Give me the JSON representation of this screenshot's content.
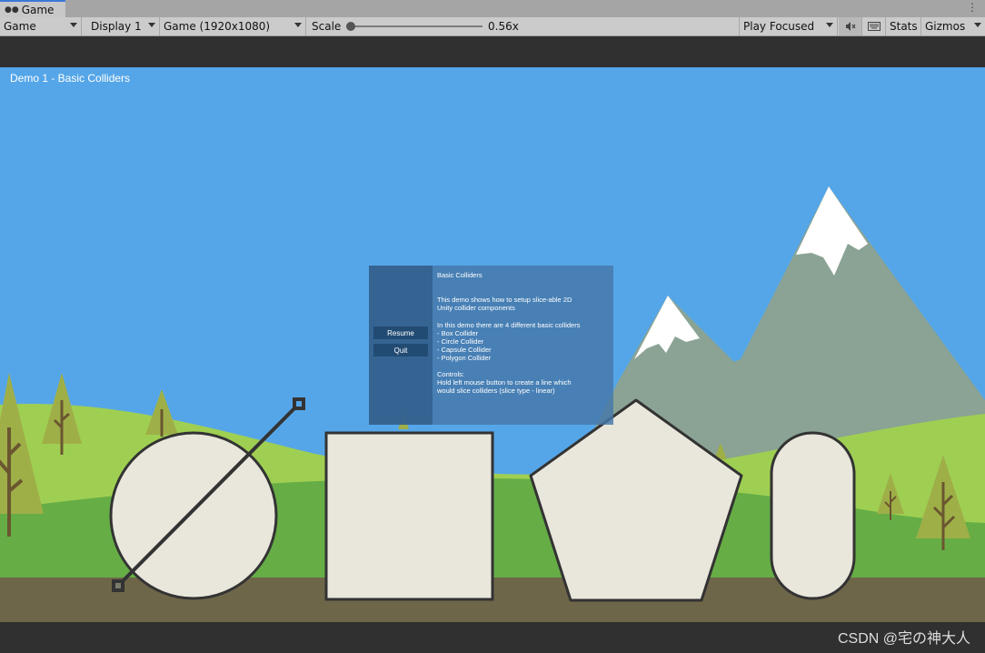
{
  "window": {
    "tab_label": "Game",
    "tab_icon": "gamepad-icon",
    "menu_icon": "kebab-menu-icon"
  },
  "toolbar": {
    "view_mode": "Game",
    "display": "Display 1",
    "resolution": "Game (1920x1080)",
    "scale_label": "Scale",
    "scale_value": "0.56x",
    "play_mode": "Play Focused",
    "mute_icon": "audio-mute-icon",
    "keyboard_icon": "keyboard-icon",
    "stats_label": "Stats",
    "gizmos_label": "Gizmos"
  },
  "scene": {
    "title": "Demo 1 - Basic Colliders",
    "colors": {
      "sky": "#55a6e8",
      "ground": "#6e6649",
      "grass_light": "#9fcf52",
      "grass_dark": "#66ad46",
      "mountain": "#8aa394",
      "snow": "#ffffff",
      "shape_fill": "#e9e7dc",
      "shape_stroke": "#333333"
    }
  },
  "panel": {
    "resume_label": "Resume",
    "quit_label": "Quit",
    "lines": [
      "Basic Colliders",
      "",
      "",
      "This demo shows how to setup slice-able 2D",
      "Unity collider components",
      "",
      "In this demo there are 4 different basic colliders",
      "- Box Collider",
      "- Circle Collider",
      "- Capsule Collider",
      "- Polygon Collider",
      "",
      "Controls:",
      "Hold left mouse button to create a line which",
      "would slice colliders (slice type - linear)"
    ]
  },
  "watermark": "CSDN @宅の神大人"
}
